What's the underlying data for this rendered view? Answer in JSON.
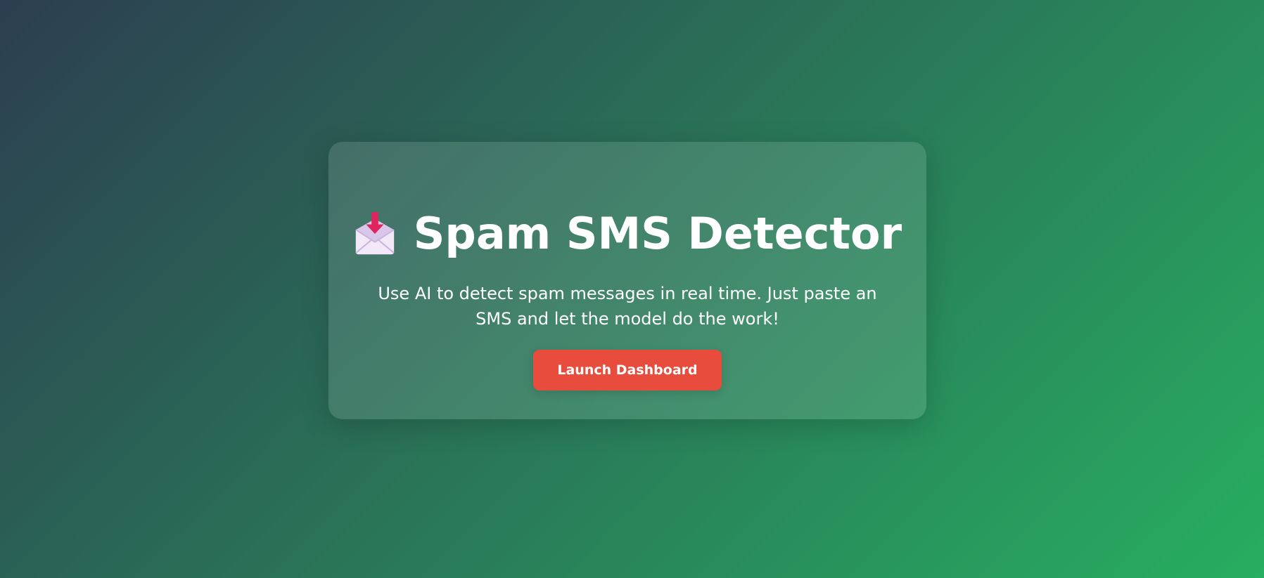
{
  "hero": {
    "icon": "envelope-with-arrow-icon",
    "title": "Spam SMS Detector",
    "subtitle": "Use AI to detect spam messages in real time. Just paste an SMS and let the model do the work!",
    "button_label": "Launch Dashboard"
  },
  "colors": {
    "background_start": "#2c3e50",
    "background_end": "#27ae60",
    "button": "#e74c3c",
    "text": "#ffffff"
  }
}
